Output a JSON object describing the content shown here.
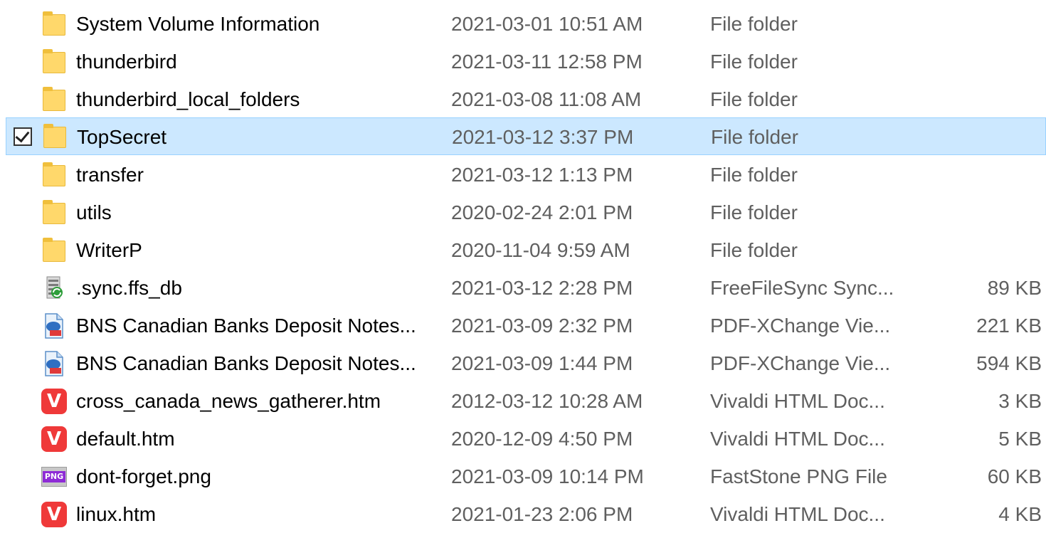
{
  "rows": [
    {
      "name": "System Volume Information",
      "date": "2021-03-01 10:51 AM",
      "type": "File folder",
      "size": "",
      "icon": "folder-icon"
    },
    {
      "name": "thunderbird",
      "date": "2021-03-11 12:58 PM",
      "type": "File folder",
      "size": "",
      "icon": "folder-icon"
    },
    {
      "name": "thunderbird_local_folders",
      "date": "2021-03-08 11:08 AM",
      "type": "File folder",
      "size": "",
      "icon": "folder-icon"
    },
    {
      "name": "TopSecret",
      "date": "2021-03-12 3:37 PM",
      "type": "File folder",
      "size": "",
      "icon": "folder-icon",
      "selected": true,
      "checked": true
    },
    {
      "name": "transfer",
      "date": "2021-03-12 1:13 PM",
      "type": "File folder",
      "size": "",
      "icon": "folder-icon"
    },
    {
      "name": "utils",
      "date": "2020-02-24 2:01 PM",
      "type": "File folder",
      "size": "",
      "icon": "folder-icon"
    },
    {
      "name": "WriterP",
      "date": "2020-11-04 9:59 AM",
      "type": "File folder",
      "size": "",
      "icon": "folder-icon"
    },
    {
      "name": ".sync.ffs_db",
      "date": "2021-03-12 2:28 PM",
      "type": "FreeFileSync Sync...",
      "size": "89 KB",
      "icon": "freefilesync-db-icon"
    },
    {
      "name": "BNS Canadian Banks Deposit Notes...",
      "date": "2021-03-09 2:32 PM",
      "type": "PDF-XChange Vie...",
      "size": "221 KB",
      "icon": "pdf-xchange-icon"
    },
    {
      "name": "BNS Canadian Banks Deposit Notes...",
      "date": "2021-03-09 1:44 PM",
      "type": "PDF-XChange Vie...",
      "size": "594 KB",
      "icon": "pdf-xchange-icon"
    },
    {
      "name": "cross_canada_news_gatherer.htm",
      "date": "2012-03-12 10:28 AM",
      "type": "Vivaldi HTML Doc...",
      "size": "3 KB",
      "icon": "vivaldi-icon"
    },
    {
      "name": "default.htm",
      "date": "2020-12-09 4:50 PM",
      "type": "Vivaldi HTML Doc...",
      "size": "5 KB",
      "icon": "vivaldi-icon"
    },
    {
      "name": "dont-forget.png",
      "date": "2021-03-09 10:14 PM",
      "type": "FastStone PNG File",
      "size": "60 KB",
      "icon": "png-file-icon",
      "icon_text": "PNG"
    },
    {
      "name": "linux.htm",
      "date": "2021-01-23 2:06 PM",
      "type": "Vivaldi HTML Doc...",
      "size": "4 KB",
      "icon": "vivaldi-icon"
    }
  ],
  "colors": {
    "selection_bg": "#cce8ff",
    "selection_border": "#99d1ff",
    "secondary_text": "#5f5f5f",
    "folder": "#ffd86b",
    "vivaldi": "#ef3939",
    "png_label": "#8e2bd6"
  }
}
